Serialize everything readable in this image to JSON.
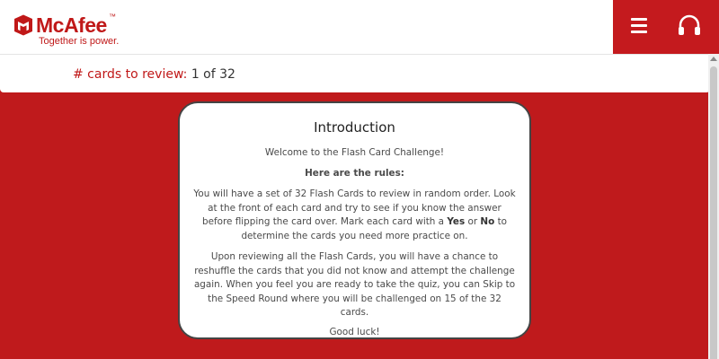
{
  "header": {
    "logo_word": "McAfee",
    "logo_tm": "™",
    "tagline": "Together is power.",
    "menu_icon": "hamburger-menu-icon",
    "support_icon": "headset-icon",
    "brand_color": "#c01818"
  },
  "progress": {
    "label": "# cards to review:",
    "value": "1 of 32"
  },
  "card": {
    "title": "Introduction",
    "welcome": "Welcome to the Flash Card Challenge!",
    "rules_heading": "Here are the rules:",
    "body1_a": "You will have a set of 32 Flash Cards to review in random order. Look at the front of each card and try to see if you know the answer before flipping the card over. Mark each card with a ",
    "yes": "Yes",
    "body1_b": " or ",
    "no": "No",
    "body1_c": " to determine the cards you need more practice on.",
    "body2": "Upon reviewing all the Flash Cards, you will have a chance to reshuffle the cards that you did not know and attempt the challenge again. When you feel you are ready to take the quiz, you can Skip to the Speed Round where you will be challenged on 15 of the 32 cards.",
    "closing": "Good luck!"
  },
  "colors": {
    "background": "#bf1a1c",
    "nav": "#c41a1e"
  }
}
